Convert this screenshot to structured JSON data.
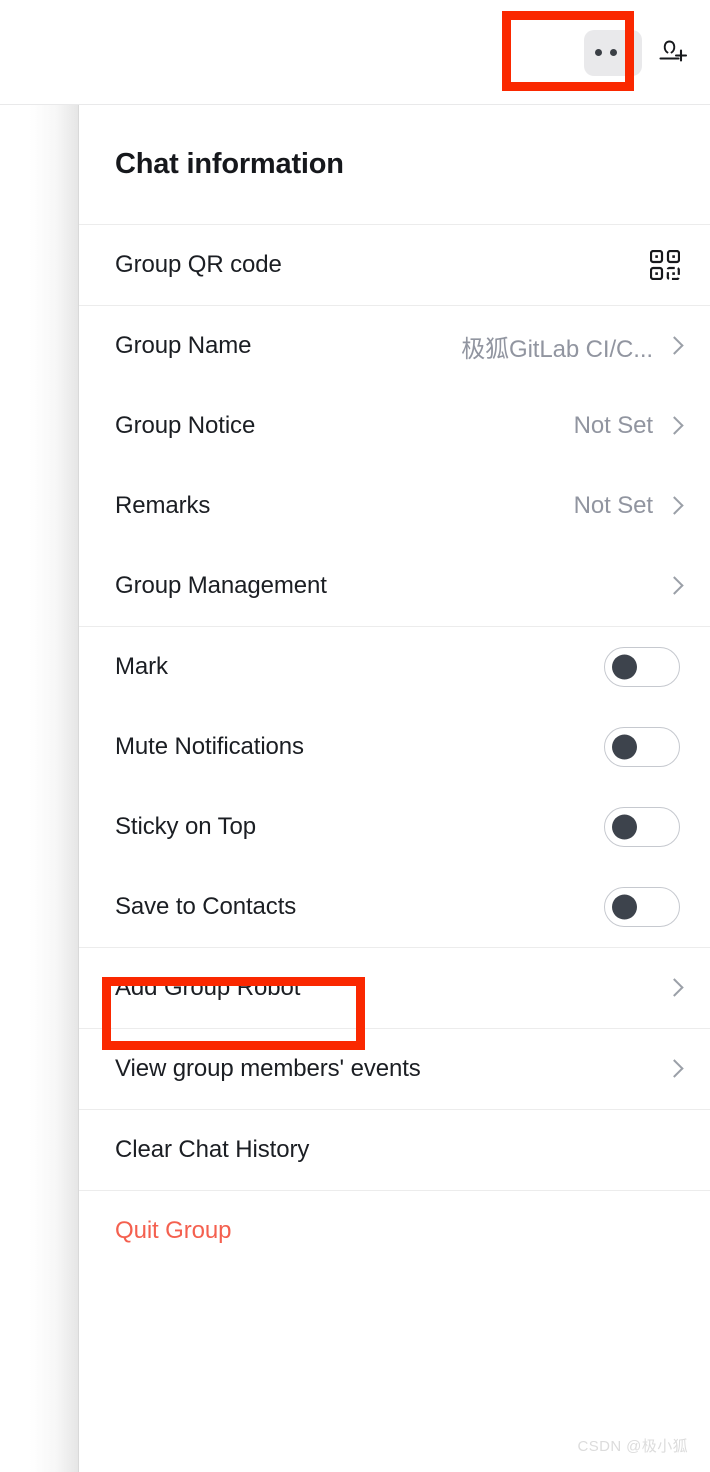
{
  "topbar": {
    "more_button": {
      "name": "more-options",
      "label": "•••"
    },
    "add_member_button": {
      "label": "Add Member"
    },
    "highlight_color": "#fa2800"
  },
  "panel": {
    "title": "Chat information",
    "sections": [
      {
        "id": "qr",
        "rows": [
          {
            "label": "Group QR code",
            "value": "",
            "accessory": "qr-icon"
          }
        ]
      },
      {
        "id": "details",
        "rows": [
          {
            "label": "Group Name",
            "value": "极狐GitLab CI/C...",
            "accessory": "chevron"
          },
          {
            "label": "Group Notice",
            "value": "Not Set",
            "accessory": "chevron"
          },
          {
            "label": "Remarks",
            "value": "Not Set",
            "accessory": "chevron"
          },
          {
            "label": "Group Management",
            "value": "",
            "accessory": "chevron"
          }
        ]
      },
      {
        "id": "toggles",
        "rows": [
          {
            "label": "Mark",
            "value": "",
            "accessory": "toggle",
            "on": false
          },
          {
            "label": "Mute Notifications",
            "value": "",
            "accessory": "toggle",
            "on": false
          },
          {
            "label": "Sticky on Top",
            "value": "",
            "accessory": "toggle",
            "on": false
          },
          {
            "label": "Save to Contacts",
            "value": "",
            "accessory": "toggle",
            "on": false
          }
        ]
      },
      {
        "id": "robot",
        "rows": [
          {
            "label": "Add Group Robot",
            "value": "",
            "accessory": "chevron",
            "highlighted": true
          }
        ]
      },
      {
        "id": "events",
        "rows": [
          {
            "label": "View group members' events",
            "value": "",
            "accessory": "chevron"
          }
        ]
      },
      {
        "id": "clear",
        "rows": [
          {
            "label": "Clear Chat History",
            "value": "",
            "accessory": "none"
          }
        ]
      },
      {
        "id": "quit",
        "rows": [
          {
            "label": "Quit Group",
            "value": "",
            "accessory": "none",
            "danger": true
          }
        ]
      }
    ]
  },
  "watermark": "CSDN @极小狐",
  "colors": {
    "accent_highlight": "#fa2800",
    "danger_text": "#f4604f",
    "muted_text": "#9195a0",
    "primary_text": "#1b1e23",
    "divider": "#ececec",
    "toggle_knob": "#3d434c",
    "more_button_bg": "#e9e9eb"
  }
}
